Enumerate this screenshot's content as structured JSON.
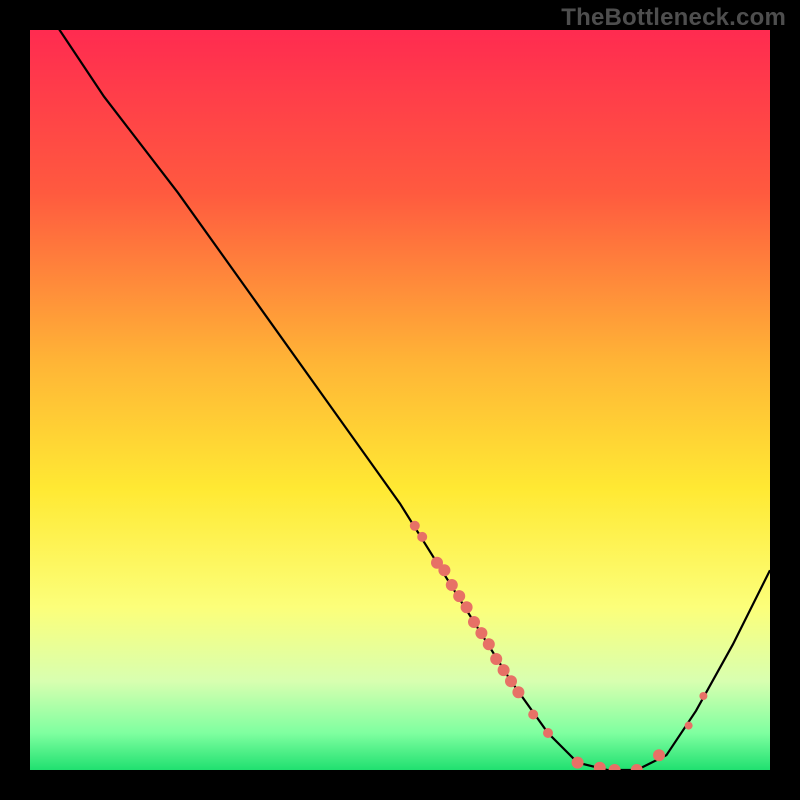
{
  "watermark": "TheBottleneck.com",
  "colors": {
    "gradient": [
      {
        "offset": "0%",
        "color": "#ff2b50"
      },
      {
        "offset": "22%",
        "color": "#ff5a3f"
      },
      {
        "offset": "45%",
        "color": "#ffb536"
      },
      {
        "offset": "62%",
        "color": "#ffe933"
      },
      {
        "offset": "78%",
        "color": "#fcff7a"
      },
      {
        "offset": "88%",
        "color": "#d8ffb0"
      },
      {
        "offset": "95%",
        "color": "#7fffa0"
      },
      {
        "offset": "100%",
        "color": "#20e070"
      }
    ],
    "curve": "#000000",
    "marker": "#e77166"
  },
  "chart_data": {
    "type": "line",
    "title": "",
    "xlabel": "",
    "ylabel": "",
    "xlim": [
      0,
      100
    ],
    "ylim": [
      0,
      100
    ],
    "curve": [
      {
        "x": 0,
        "y": 105
      },
      {
        "x": 4,
        "y": 100
      },
      {
        "x": 10,
        "y": 91
      },
      {
        "x": 20,
        "y": 78
      },
      {
        "x": 30,
        "y": 64
      },
      {
        "x": 40,
        "y": 50
      },
      {
        "x": 50,
        "y": 36
      },
      {
        "x": 55,
        "y": 28
      },
      {
        "x": 60,
        "y": 20
      },
      {
        "x": 65,
        "y": 12
      },
      {
        "x": 70,
        "y": 5
      },
      {
        "x": 74,
        "y": 1
      },
      {
        "x": 78,
        "y": 0
      },
      {
        "x": 82,
        "y": 0
      },
      {
        "x": 86,
        "y": 2
      },
      {
        "x": 90,
        "y": 8
      },
      {
        "x": 95,
        "y": 17
      },
      {
        "x": 100,
        "y": 27
      }
    ],
    "markers": [
      {
        "x": 52,
        "y": 33,
        "r": 5
      },
      {
        "x": 53,
        "y": 31.5,
        "r": 5
      },
      {
        "x": 55,
        "y": 28,
        "r": 6
      },
      {
        "x": 56,
        "y": 27,
        "r": 6
      },
      {
        "x": 57,
        "y": 25,
        "r": 6
      },
      {
        "x": 58,
        "y": 23.5,
        "r": 6
      },
      {
        "x": 59,
        "y": 22,
        "r": 6
      },
      {
        "x": 60,
        "y": 20,
        "r": 6
      },
      {
        "x": 61,
        "y": 18.5,
        "r": 6
      },
      {
        "x": 62,
        "y": 17,
        "r": 6
      },
      {
        "x": 63,
        "y": 15,
        "r": 6
      },
      {
        "x": 64,
        "y": 13.5,
        "r": 6
      },
      {
        "x": 65,
        "y": 12,
        "r": 6
      },
      {
        "x": 66,
        "y": 10.5,
        "r": 6
      },
      {
        "x": 68,
        "y": 7.5,
        "r": 5
      },
      {
        "x": 70,
        "y": 5,
        "r": 5
      },
      {
        "x": 74,
        "y": 1,
        "r": 6
      },
      {
        "x": 77,
        "y": 0.3,
        "r": 6
      },
      {
        "x": 79,
        "y": 0,
        "r": 6
      },
      {
        "x": 82,
        "y": 0,
        "r": 6
      },
      {
        "x": 85,
        "y": 2,
        "r": 6
      },
      {
        "x": 89,
        "y": 6,
        "r": 4
      },
      {
        "x": 91,
        "y": 10,
        "r": 4
      }
    ]
  }
}
